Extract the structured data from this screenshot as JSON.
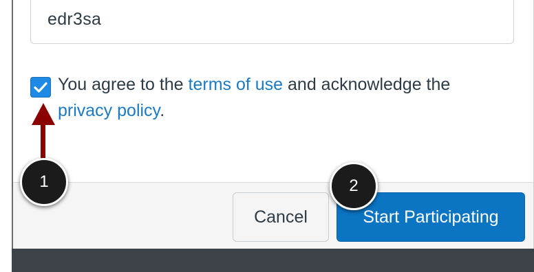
{
  "form": {
    "code_value": "edr3sa",
    "agree": {
      "checked": true,
      "prefix": "You agree to the ",
      "terms_link": "terms of use",
      "middle": " and acknowledge the",
      "privacy_link": "privacy policy",
      "suffix": "."
    }
  },
  "footer": {
    "cancel_label": "Cancel",
    "start_label": "Start Participating"
  },
  "annotations": {
    "step1": "1",
    "step2": "2"
  },
  "colors": {
    "primary": "#0b74c3",
    "link": "#1b7ac4",
    "checkbox": "#1f8ae6",
    "arrow": "#8b0000",
    "badge": "#1b1b1b"
  },
  "icons": {
    "checkbox": "checkmark-icon",
    "arrow": "arrow-up-icon"
  }
}
